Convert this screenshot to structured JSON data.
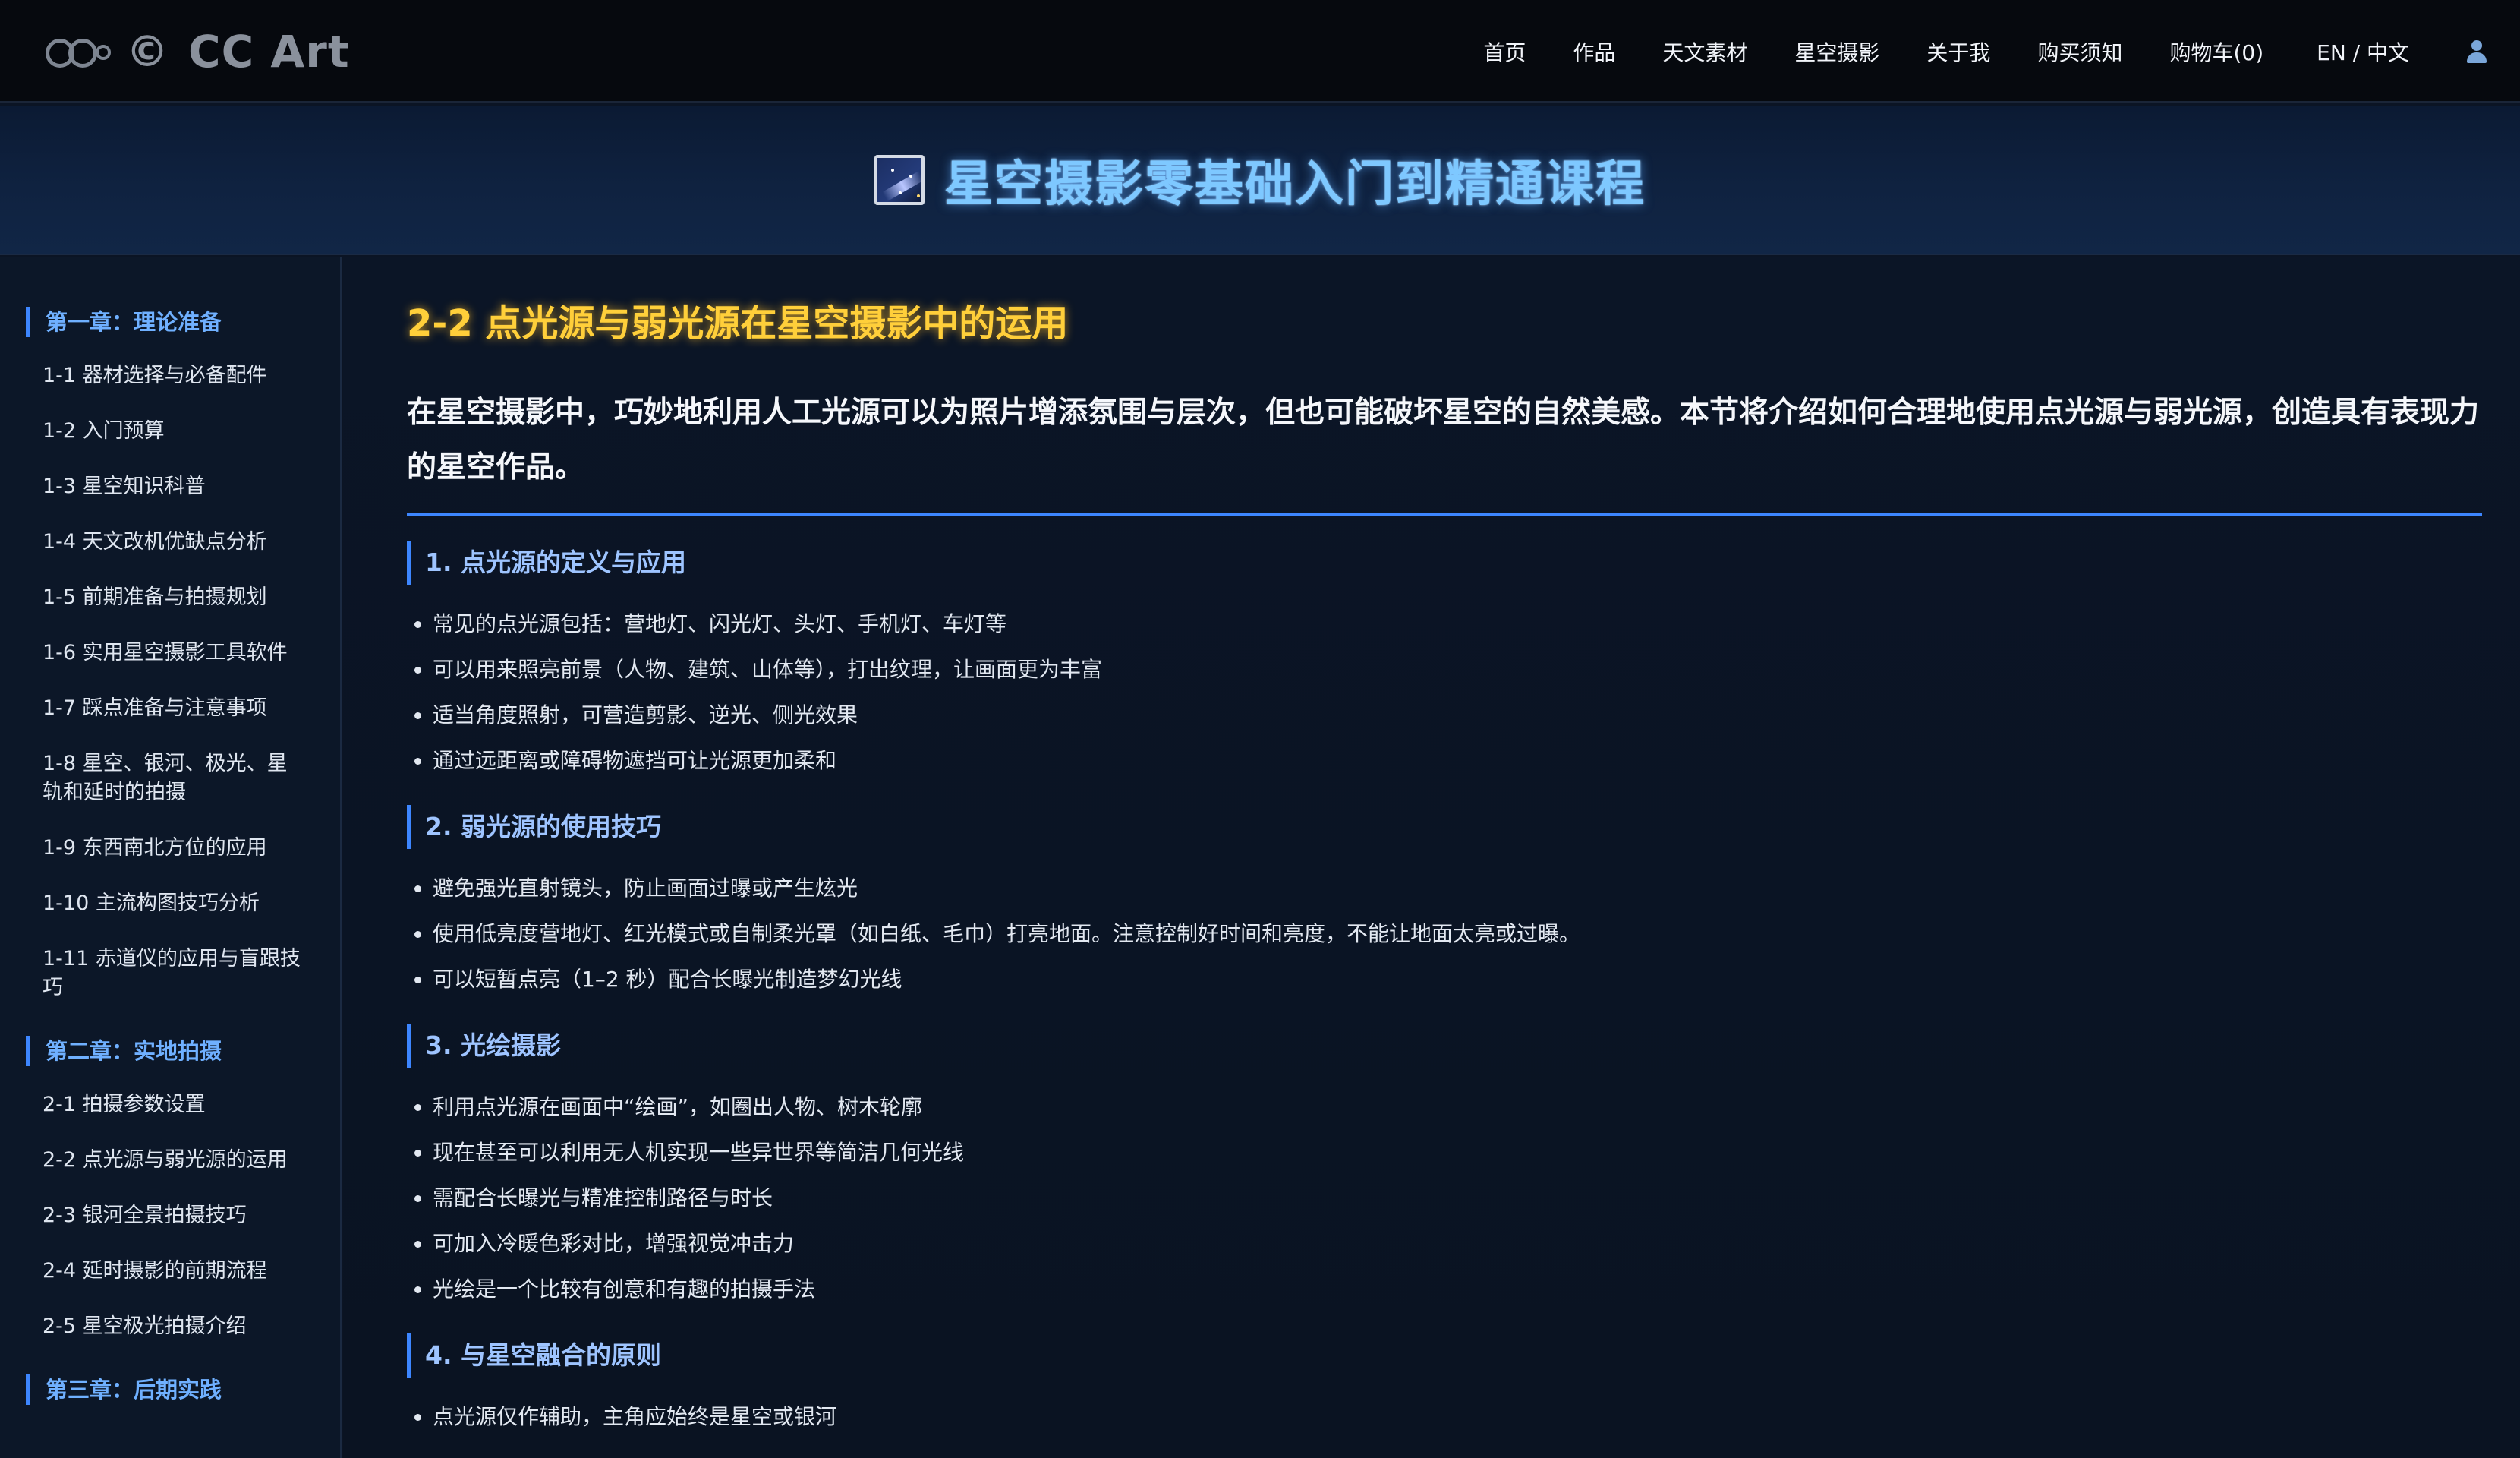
{
  "header": {
    "logo_copyright": "©",
    "logo_text": "CC Art",
    "nav": [
      "首页",
      "作品",
      "天文素材",
      "星空摄影",
      "关于我",
      "购买须知",
      "购物车(0)"
    ],
    "lang": "EN / 中文"
  },
  "banner": {
    "title": "星空摄影零基础入门到精通课程"
  },
  "sidebar": {
    "chapters": [
      {
        "title": "第一章：理论准备",
        "items": [
          "1-1 器材选择与必备配件",
          "1-2 入门预算",
          "1-3 星空知识科普",
          "1-4 天文改机优缺点分析",
          "1-5 前期准备与拍摄规划",
          "1-6 实用星空摄影工具软件",
          "1-7 踩点准备与注意事项",
          "1-8 星空、银河、极光、星轨和延时的拍摄",
          "1-9 东西南北方位的应用",
          "1-10 主流构图技巧分析",
          "1-11 赤道仪的应用与盲跟技巧"
        ]
      },
      {
        "title": "第二章：实地拍摄",
        "items": [
          "2-1 拍摄参数设置",
          "2-2 点光源与弱光源的运用",
          "2-3 银河全景拍摄技巧",
          "2-4 延时摄影的前期流程",
          "2-5 星空极光拍摄介绍"
        ]
      },
      {
        "title": "第三章：后期实践",
        "items": []
      }
    ]
  },
  "main": {
    "title": "2-2 点光源与弱光源在星空摄影中的运用",
    "intro": "在星空摄影中，巧妙地利用人工光源可以为照片增添氛围与层次，但也可能破坏星空的自然美感。本节将介绍如何合理地使用点光源与弱光源，创造具有表现力的星空作品。",
    "sections": [
      {
        "heading": "1. 点光源的定义与应用",
        "bullets": [
          "常见的点光源包括：营地灯、闪光灯、头灯、手机灯、车灯等",
          "可以用来照亮前景（人物、建筑、山体等），打出纹理，让画面更为丰富",
          "适当角度照射，可营造剪影、逆光、侧光效果",
          "通过远距离或障碍物遮挡可让光源更加柔和"
        ]
      },
      {
        "heading": "2. 弱光源的使用技巧",
        "bullets": [
          "避免强光直射镜头，防止画面过曝或产生炫光",
          "使用低亮度营地灯、红光模式或自制柔光罩（如白纸、毛巾）打亮地面。注意控制好时间和亮度，不能让地面太亮或过曝。",
          "可以短暂点亮（1–2 秒）配合长曝光制造梦幻光线"
        ]
      },
      {
        "heading": "3. 光绘摄影",
        "bullets": [
          "利用点光源在画面中“绘画”，如圈出人物、树木轮廓",
          "现在甚至可以利用无人机实现一些异世界等简洁几何光线",
          "需配合长曝光与精准控制路径与时长",
          "可加入冷暖色彩对比，增强视觉冲击力",
          "光绘是一个比较有创意和有趣的拍摄手法"
        ]
      },
      {
        "heading": "4. 与星空融合的原则",
        "bullets": [
          "点光源仅作辅助，主角应始终是星空或银河"
        ]
      }
    ]
  }
}
